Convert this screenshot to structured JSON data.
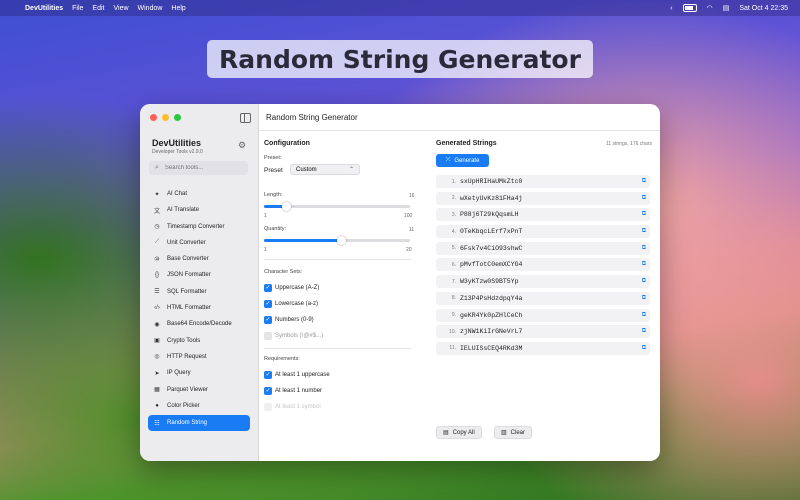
{
  "menubar": {
    "app_name": "DevUtilities",
    "menus": [
      "File",
      "Edit",
      "View",
      "Window",
      "Help"
    ],
    "clock": "Sat Oct 4  22:35"
  },
  "banner": {
    "title": "Random String Generator"
  },
  "sidebar": {
    "app_title": "DevUtilities",
    "version": "Developer Tools v2.9.0",
    "search_placeholder": "Search tools...",
    "items": [
      {
        "label": "AI Chat",
        "icon": "sparkles-icon"
      },
      {
        "label": "AI Translate",
        "icon": "translate-icon"
      },
      {
        "label": "Timestamp Converter",
        "icon": "clock-icon"
      },
      {
        "label": "Unit Converter",
        "icon": "ruler-icon"
      },
      {
        "label": "Base Converter",
        "icon": "number-icon"
      },
      {
        "label": "JSON Formatter",
        "icon": "braces-icon"
      },
      {
        "label": "SQL Formatter",
        "icon": "database-icon"
      },
      {
        "label": "HTML Formatter",
        "icon": "code-icon"
      },
      {
        "label": "Base64 Encode/Decode",
        "icon": "encode-icon"
      },
      {
        "label": "Crypto Tools",
        "icon": "lock-icon"
      },
      {
        "label": "HTTP Request",
        "icon": "globe-icon"
      },
      {
        "label": "IP Query",
        "icon": "location-icon"
      },
      {
        "label": "Parquet Viewer",
        "icon": "table-icon"
      },
      {
        "label": "Color Picker",
        "icon": "palette-icon"
      },
      {
        "label": "Random String",
        "icon": "text-icon",
        "active": true
      }
    ]
  },
  "main": {
    "title": "Random String Generator",
    "config": {
      "heading": "Configuration",
      "preset_label": "Preset:",
      "preset_inline": "Preset",
      "preset_value": "Custom",
      "length_label": "Length:",
      "length_value": "16",
      "length_min": "1",
      "length_max": "100",
      "length_level": 0.15,
      "quantity_label": "Quantity:",
      "quantity_value": "11",
      "quantity_min": "1",
      "quantity_max": "20",
      "quantity_level": 0.53,
      "charsets_label": "Character Sets:",
      "charsets": [
        {
          "label": "Uppercase (A-Z)",
          "checked": true
        },
        {
          "label": "Lowercase (a-z)",
          "checked": true
        },
        {
          "label": "Numbers (0-9)",
          "checked": true
        },
        {
          "label": "Symbols (!@#$...)",
          "checked": false
        }
      ],
      "requirements_label": "Requirements:",
      "requirements": [
        {
          "label": "At least 1 uppercase",
          "checked": true
        },
        {
          "label": "At least 1 number",
          "checked": true
        },
        {
          "label": "At least 1 symbol",
          "checked": false
        }
      ]
    },
    "output": {
      "heading": "Generated Strings",
      "count": "11 strings, 176 chars",
      "generate_label": "Generate",
      "strings": [
        "sxUpHRIHaUMkZtc0",
        "wXetyUvKz81FHa4j",
        "P88j6T29kQqsmLH",
        "0TeKbqcLErf7xPnT",
        "6Fsk7v4CiO93shwC",
        "pMvfTotC0emXCYG4",
        "W3yKTzw0S9BT5Yp",
        "Z13P4PsHdzdpqY4a",
        "geKR4Yk0pZHlCeCh",
        "zjNW1KiIrGNeVrL7",
        "IELUISsCEQ4RKd3M"
      ],
      "copy_all_label": "Copy All",
      "clear_label": "Clear"
    }
  },
  "colors": {
    "accent": "#1a7cf5"
  }
}
